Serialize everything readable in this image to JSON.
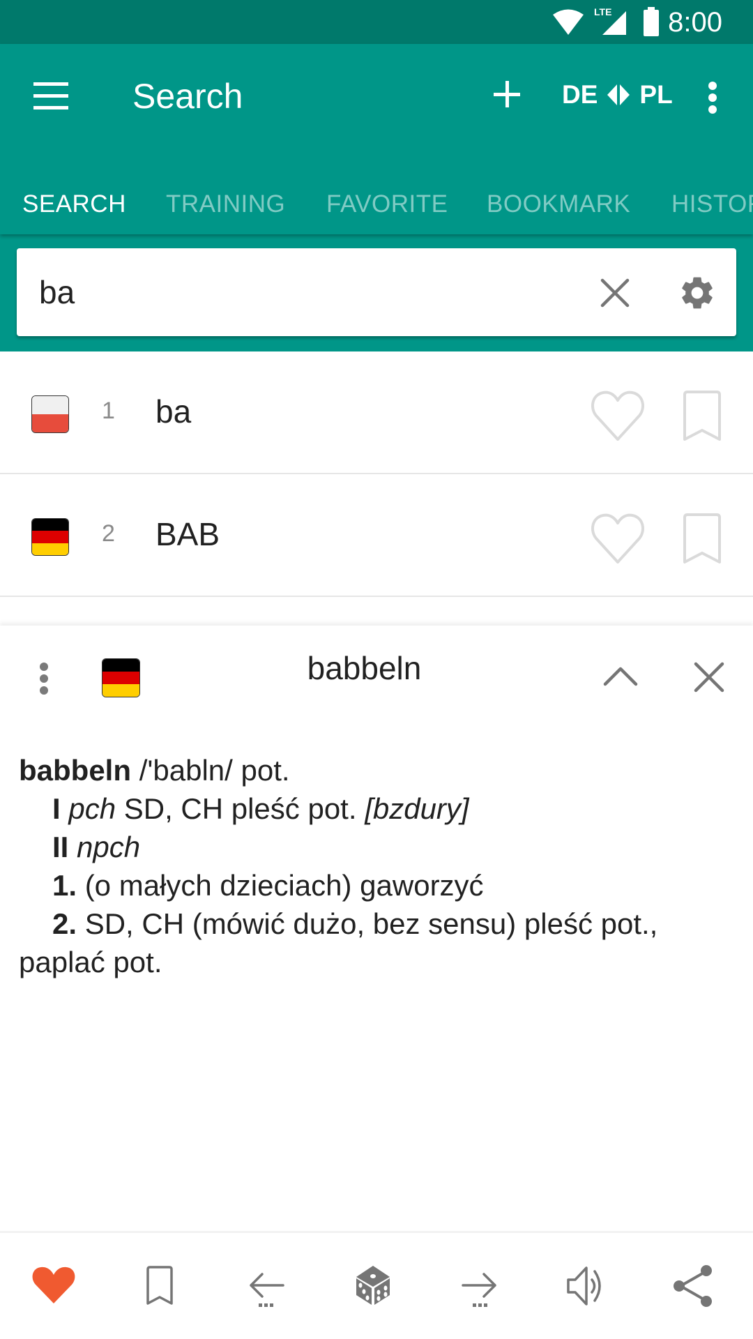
{
  "status_bar": {
    "time": "8:00",
    "icons": [
      "wifi-icon",
      "lte-signal-icon",
      "battery-icon"
    ],
    "network_label": "LTE"
  },
  "app_bar": {
    "title": "Search",
    "menu_icon": "hamburger-menu-icon",
    "add_icon": "plus-icon",
    "language_pair": {
      "source": "DE",
      "target": "PL",
      "swap_icon": "swap-arrows-icon"
    },
    "overflow_icon": "more-vert-icon"
  },
  "tabs": [
    {
      "label": "SEARCH",
      "active": true
    },
    {
      "label": "TRAINING",
      "active": false
    },
    {
      "label": "FAVORITE",
      "active": false
    },
    {
      "label": "BOOKMARK",
      "active": false
    },
    {
      "label": "HISTORY",
      "active": false
    }
  ],
  "search": {
    "value": "ba",
    "placeholder": "",
    "clear_icon": "close-icon",
    "settings_icon": "gear-icon"
  },
  "results": [
    {
      "index": "1",
      "word": "ba",
      "language": "PL",
      "flag": "poland-flag",
      "favorite": false,
      "bookmarked": false
    },
    {
      "index": "2",
      "word": "BAB",
      "language": "DE",
      "flag": "germany-flag",
      "favorite": false,
      "bookmarked": false
    }
  ],
  "detail": {
    "title": "babbeln",
    "language": "DE",
    "flag": "germany-flag",
    "definition": {
      "headword": "babbeln",
      "pronunciation": "/'babln/ pot.",
      "sense_I_num": "I",
      "sense_I_gram": "pch",
      "sense_I_text": " SD, CH pleść pot. ",
      "sense_I_note": "[bzdury]",
      "sense_II_num": "II",
      "sense_II_gram": "npch",
      "sub1_num": "1.",
      "sub1_text": " (o małych dzieciach) gaworzyć",
      "sub2_num": "2.",
      "sub2_text": " SD, CH (mówić dużo, bez sensu) pleść pot.,",
      "sub2_cont": "paplać pot."
    }
  },
  "bottom_bar": {
    "items": [
      {
        "name": "favorite",
        "icon": "heart-filled-icon",
        "active": true
      },
      {
        "name": "bookmark",
        "icon": "bookmark-icon",
        "active": false
      },
      {
        "name": "previous",
        "icon": "arrow-back-icon",
        "active": false
      },
      {
        "name": "random",
        "icon": "dice-icon",
        "active": false
      },
      {
        "name": "next",
        "icon": "arrow-forward-icon",
        "active": false
      },
      {
        "name": "pronounce",
        "icon": "speaker-icon",
        "active": false
      },
      {
        "name": "share",
        "icon": "share-icon",
        "active": false
      }
    ]
  },
  "colors": {
    "primary": "#009688",
    "primary_dark": "#00796B",
    "tab_inactive": "#80CBC4",
    "favorite_active": "#F05A30",
    "icon_gray": "#757575",
    "icon_light": "#DADADA",
    "poland_red": "#E74C3C",
    "poland_white": "#F0F0F0",
    "germany_black": "#000000",
    "germany_red": "#DD0000",
    "germany_gold": "#FFCE00"
  }
}
